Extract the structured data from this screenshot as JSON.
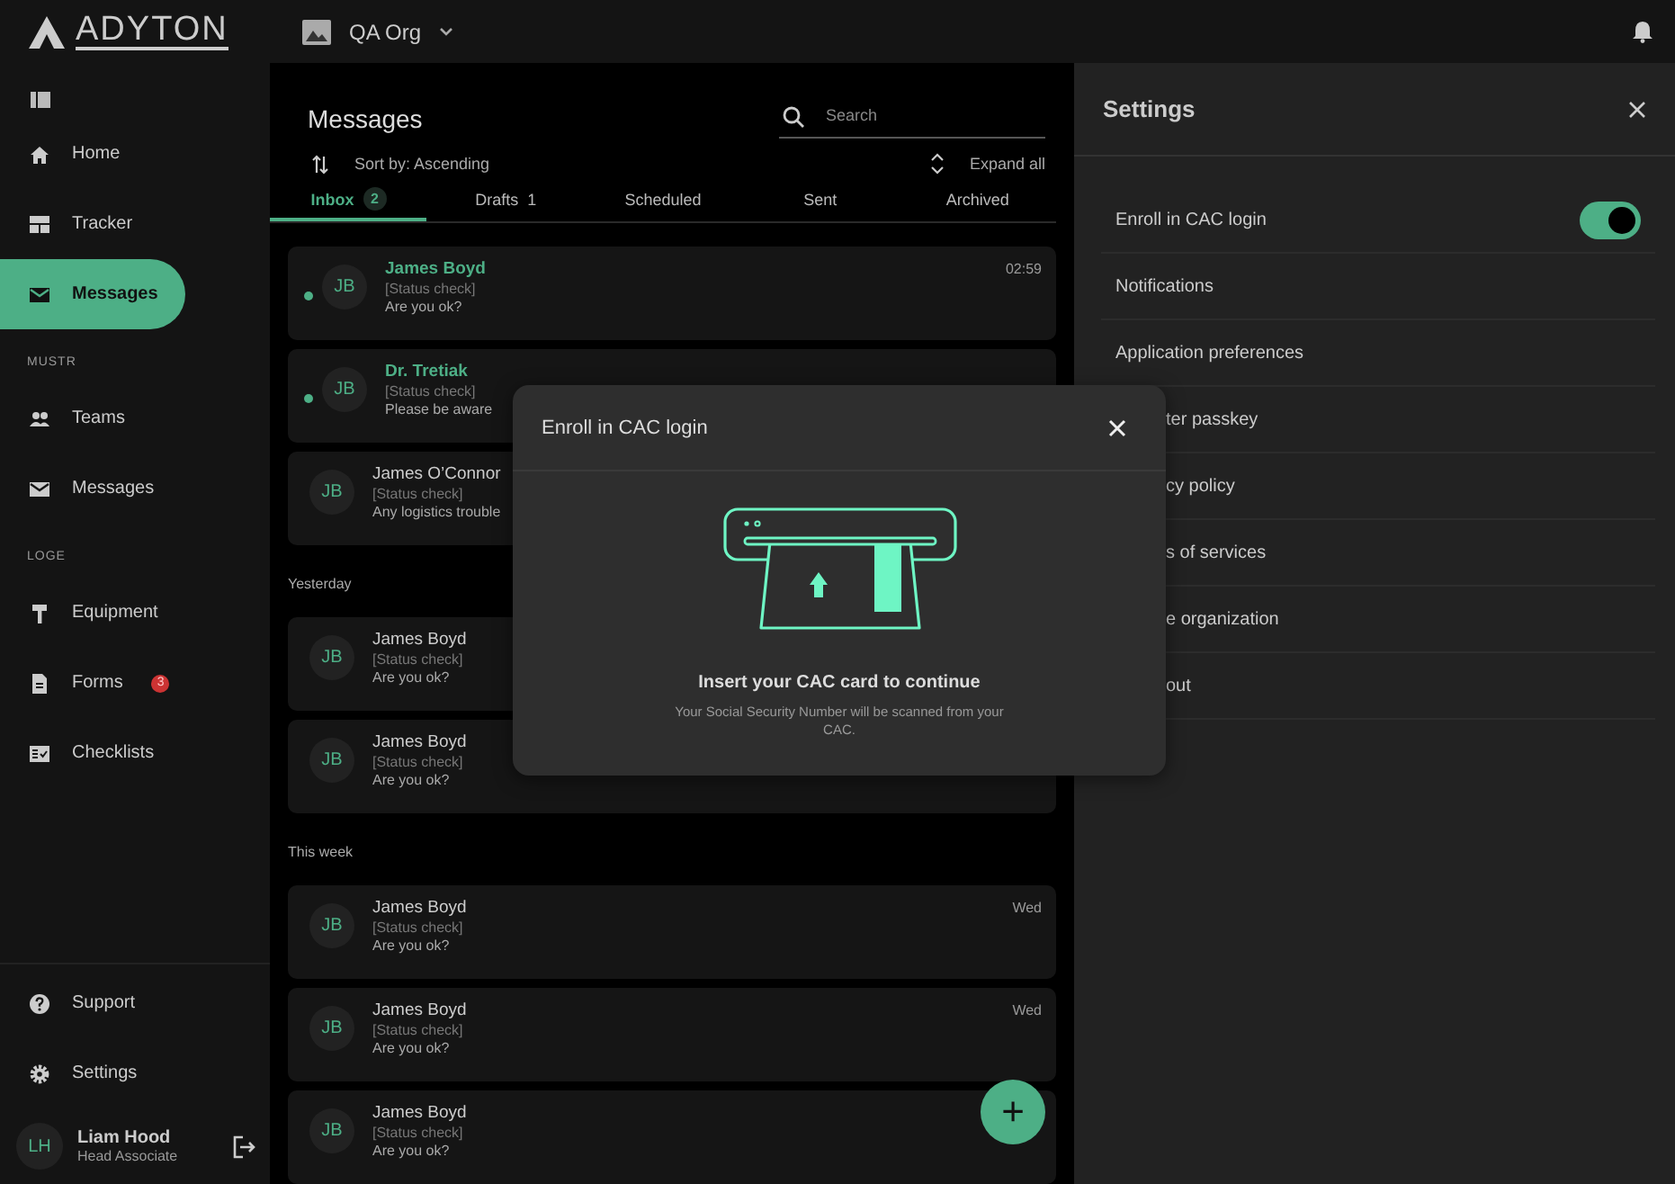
{
  "topbar": {
    "logo": "ADYTON",
    "org": "QA Org"
  },
  "sidebar": {
    "groups": [
      {
        "items": [
          {
            "label": "Home",
            "selected": false
          },
          {
            "label": "Tracker",
            "selected": false
          },
          {
            "label": "Messages",
            "selected": true
          }
        ]
      },
      {
        "heading": "MUSTR",
        "items": [
          {
            "label": "Teams",
            "selected": false
          },
          {
            "label": "Messages",
            "selected": false
          }
        ]
      },
      {
        "heading": "LOGE",
        "items": [
          {
            "label": "Equipment",
            "selected": false
          },
          {
            "label": "Forms",
            "badge": "3",
            "selected": false
          },
          {
            "label": "Checklists",
            "selected": false
          }
        ]
      }
    ],
    "footer_items": [
      {
        "label": "Support"
      },
      {
        "label": "Settings"
      }
    ],
    "user": {
      "initials": "LH",
      "name": "Liam Hood",
      "role": "Head Associate"
    }
  },
  "messages": {
    "title": "Messages",
    "search": {
      "placeholder": "Search"
    },
    "sort": "Sort by: Ascending",
    "expand": "Expand all",
    "tabs": [
      {
        "label": "Inbox",
        "count": "2",
        "selected": true
      },
      {
        "label": "Drafts",
        "count": "1",
        "selected": false
      },
      {
        "label": "Scheduled",
        "selected": false
      },
      {
        "label": "Sent",
        "selected": false
      },
      {
        "label": "Archived",
        "selected": false
      }
    ],
    "groups": [
      {
        "messages": [
          {
            "initials": "JB",
            "name": "James Boyd",
            "subject": "[Status check]",
            "preview": "Are you ok?",
            "time": "02:59",
            "unread": true
          },
          {
            "initials": "JB",
            "name": "Dr. Tretiak",
            "subject": "[Status check]",
            "preview": "Please be aware",
            "unread": true
          },
          {
            "initials": "JB",
            "name": "James O’Connor",
            "subject": "[Status check]",
            "preview": "Any logistics trouble",
            "unread": false
          }
        ]
      },
      {
        "heading": "Yesterday",
        "messages": [
          {
            "initials": "JB",
            "name": "James Boyd",
            "subject": "[Status check]",
            "preview": "Are you ok?",
            "unread": false
          },
          {
            "initials": "JB",
            "name": "James Boyd",
            "subject": "[Status check]",
            "preview": "Are you ok?",
            "unread": false
          }
        ]
      },
      {
        "heading": "This week",
        "messages": [
          {
            "initials": "JB",
            "name": "James Boyd",
            "subject": "[Status check]",
            "preview": "Are you ok?",
            "time": "Wed",
            "unread": false
          },
          {
            "initials": "JB",
            "name": "James Boyd",
            "subject": "[Status check]",
            "preview": "Are you ok?",
            "time": "Wed",
            "unread": false
          },
          {
            "initials": "JB",
            "name": "James Boyd",
            "subject": "[Status check]",
            "preview": "Are you ok?",
            "unread": false
          }
        ]
      }
    ],
    "fab": "+"
  },
  "settings": {
    "title": "Settings",
    "items": [
      {
        "label": "Enroll in CAC login",
        "kind": "toggle",
        "on": true
      },
      {
        "label": "Notifications",
        "kind": "link"
      },
      {
        "label": "Application preferences",
        "kind": "link"
      },
      {
        "label": "ter passkey",
        "kind": "link",
        "covered": true
      },
      {
        "label": "cy policy",
        "kind": "link",
        "covered": true
      },
      {
        "label": "s of services",
        "kind": "link",
        "covered": true
      },
      {
        "label": "e organization",
        "kind": "link",
        "covered": true
      },
      {
        "label": "out",
        "kind": "link",
        "covered": true
      }
    ]
  },
  "dialog": {
    "title": "Enroll in CAC login",
    "heading": "Insert your CAC card to continue",
    "text": "Your Social Security Number will be scanned from your CAC."
  }
}
